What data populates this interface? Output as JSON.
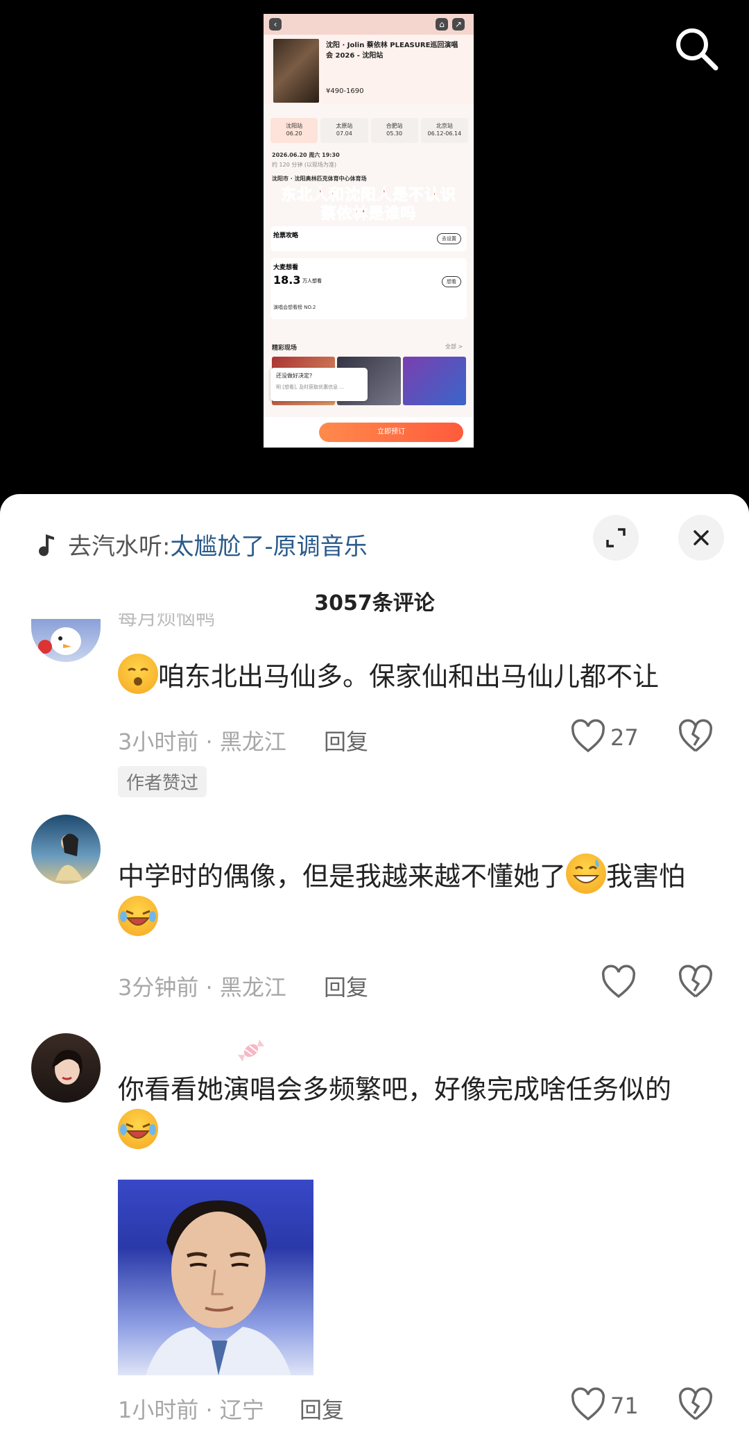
{
  "video": {
    "phone": {
      "title": "沈阳 · Jolin 蔡依林 PLEASURE巡回演唱会 2026 - 沈阳站",
      "price": "¥490-1690",
      "stations": [
        {
          "name": "沈阳站",
          "date": "06.20"
        },
        {
          "name": "太原站",
          "date": "07.04"
        },
        {
          "name": "合肥站",
          "date": "05.30"
        },
        {
          "name": "北京站",
          "date": "06.12-06.14"
        }
      ],
      "datetime": "2026.06.20 周六 19:30",
      "duration": "约 120 分钟 (以现场为准)",
      "venue": "沈阳市 · 沈阳奥林匹克体育中心体育场",
      "overlay_line1": "东北人和沈阳人是不认识",
      "overlay_line2": "蔡依林是谁吗",
      "strategy_title": "抢票攻略",
      "strategy_btn": "去设置",
      "want_title": "大麦想看",
      "want_value": "18.3",
      "want_unit": "万人想看",
      "want_btn": "想看",
      "rank": "演唱会想看榜 NO.2",
      "highlights": "精彩现场",
      "all": "全部 >",
      "popup_title": "还没做好决定?",
      "popup_sub": "明 [想看], 及时获取优惠信息 ...",
      "buy": "立即预订"
    }
  },
  "sheet": {
    "music_prefix": "去汽水听: ",
    "music_song": "太尴尬了-原调音乐",
    "comment_count": "3057条评论"
  },
  "comments": [
    {
      "username": "每月烦恼鸭",
      "text": "咱东北出马仙多。保家仙和出马仙儿都不让",
      "meta": "3小时前 · 黑龙江",
      "reply": "回复",
      "likes": "27",
      "tag": "作者赞过"
    },
    {
      "text_a": "中学时的偶像，但是我越来越不懂她了",
      "text_b": "我害怕",
      "meta": "3分钟前 · 黑龙江",
      "reply": "回复"
    },
    {
      "text": "你看看她演唱会多频繁吧，好像完成啥任务似的",
      "meta": "1小时前 · 辽宁",
      "reply": "回复",
      "likes": "71"
    }
  ],
  "colors": {
    "accent_orange": "#ff6a3d",
    "music_link": "#2a5a8a",
    "meta_gray": "#a7a7a7"
  }
}
